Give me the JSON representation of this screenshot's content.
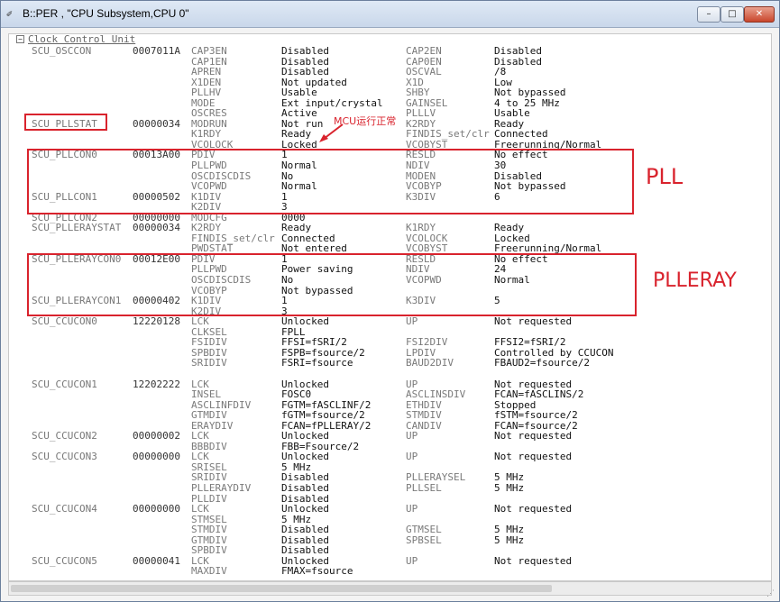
{
  "window": {
    "title": "B::PER , \"CPU Subsystem,CPU 0\"",
    "minimize": "–",
    "maximize": "□",
    "close": "✕"
  },
  "section": {
    "toggle": "−",
    "title": "Clock Control Unit"
  },
  "annotations": {
    "pll": "PLL",
    "plleray": "PLLERAY",
    "note": "MCU运行正常"
  },
  "highlight_color": "#d9232d",
  "rows": [
    [
      "SCU_OSCCON",
      "0007011A",
      "CAP3EN",
      "Disabled",
      "CAP2EN",
      "Disabled"
    ],
    [
      "",
      "",
      "CAP1EN",
      "Disabled",
      "CAP0EN",
      "Disabled"
    ],
    [
      "",
      "",
      "APREN",
      "Disabled",
      "OSCVAL",
      "/8"
    ],
    [
      "",
      "",
      "X1DEN",
      "Not updated",
      "X1D",
      "Low"
    ],
    [
      "",
      "",
      "PLLHV",
      "Usable",
      "SHBY",
      "Not bypassed"
    ],
    [
      "",
      "",
      "MODE",
      "Ext input/crystal",
      "GAINSEL",
      "4 to 25 MHz"
    ],
    [
      "",
      "",
      "OSCRES",
      "Active",
      "PLLLV",
      "Usable"
    ],
    [
      "SCU_PLLSTAT",
      "00000034",
      "MODRUN",
      "Not run",
      "K2RDY",
      "Ready"
    ],
    [
      "",
      "",
      "K1RDY",
      "Ready",
      "FINDIS_set/clr",
      "Connected"
    ],
    [
      "",
      "",
      "VCOLOCK",
      "Locked",
      "VCOBYST",
      "Freerunning/Normal"
    ],
    [
      "SCU_PLLCON0",
      "00013A00",
      "PDIV",
      "1",
      "RESLD",
      "No effect"
    ],
    [
      "",
      "",
      "PLLPWD",
      "Normal",
      "NDIV",
      "30"
    ],
    [
      "",
      "",
      "OSCDISCDIS",
      "No",
      "MODEN",
      "Disabled"
    ],
    [
      "",
      "",
      "VCOPWD",
      "Normal",
      "VCOBYP",
      "Not bypassed"
    ],
    [
      "SCU_PLLCON1",
      "00000502",
      "K1DIV",
      "1",
      "K3DIV",
      "6"
    ],
    [
      "",
      "",
      "K2DIV",
      "3",
      "",
      ""
    ],
    [
      "SCU_PLLCON2",
      "00000000",
      "MODCFG",
      "0000",
      "",
      ""
    ],
    [
      "SCU_PLLERAYSTAT",
      "00000034",
      "K2RDY",
      "Ready",
      "K1RDY",
      "Ready"
    ],
    [
      "",
      "",
      "FINDIS_set/clr",
      "Connected",
      "VCOLOCK",
      "Locked"
    ],
    [
      "",
      "",
      "PWDSTAT",
      "Not entered",
      "VCOBYST",
      "Freerunning/Normal"
    ],
    [
      "SCU_PLLERAYCON0",
      "00012E00",
      "PDIV",
      "1",
      "RESLD",
      "No effect"
    ],
    [
      "",
      "",
      "PLLPWD",
      "Power saving",
      "NDIV",
      "24"
    ],
    [
      "",
      "",
      "OSCDISCDIS",
      "No",
      "VCOPWD",
      "Normal"
    ],
    [
      "",
      "",
      "VCOBYP",
      "Not bypassed",
      "",
      ""
    ],
    [
      "SCU_PLLERAYCON1",
      "00000402",
      "K1DIV",
      "1",
      "K3DIV",
      "5"
    ],
    [
      "",
      "",
      "K2DIV",
      "3",
      "",
      ""
    ],
    [
      "SCU_CCUCON0",
      "12220128",
      "LCK",
      "Unlocked",
      "UP",
      "Not requested"
    ],
    [
      "",
      "",
      "CLKSEL",
      "FPLL",
      "",
      ""
    ],
    [
      "",
      "",
      "FSIDIV",
      "FFSI=fSRI/2",
      "FSI2DIV",
      "FFSI2=fSRI/2"
    ],
    [
      "",
      "",
      "SPBDIV",
      "FSPB=fsource/2",
      "LPDIV",
      "Controlled by CCUCON"
    ],
    [
      "",
      "",
      "SRIDIV",
      "FSRI=fsource",
      "BAUD2DIV",
      "FBAUD2=fsource/2"
    ],
    [
      "",
      "",
      "",
      "",
      "",
      ""
    ],
    [
      "SCU_CCUCON1",
      "12202222",
      "LCK",
      "Unlocked",
      "UP",
      "Not requested"
    ],
    [
      "",
      "",
      "INSEL",
      "FOSC0",
      "ASCLINSDIV",
      "FCAN=fASCLINS/2"
    ],
    [
      "",
      "",
      "ASCLINFDIV",
      "FGTM=fASCLINF/2",
      "ETHDIV",
      "Stopped"
    ],
    [
      "",
      "",
      "GTMDIV",
      "fGTM=fsource/2",
      "STMDIV",
      "fSTM=fsource/2"
    ],
    [
      "",
      "",
      "ERAYDIV",
      "FCAN=fPLLERAY/2",
      "CANDIV",
      "FCAN=fsource/2"
    ],
    [
      "SCU_CCUCON2",
      "00000002",
      "LCK",
      "Unlocked",
      "UP",
      "Not requested"
    ],
    [
      "",
      "",
      "BBBDIV",
      "FBB=Fsource/2",
      "",
      ""
    ],
    [
      "SCU_CCUCON3",
      "00000000",
      "LCK",
      "Unlocked",
      "UP",
      "Not requested"
    ],
    [
      "",
      "",
      "SRISEL",
      "5 MHz",
      "",
      ""
    ],
    [
      "",
      "",
      "SRIDIV",
      "Disabled",
      "PLLERAYSEL",
      "5 MHz"
    ],
    [
      "",
      "",
      "PLLERAYDIV",
      "Disabled",
      "PLLSEL",
      "5 MHz"
    ],
    [
      "",
      "",
      "PLLDIV",
      "Disabled",
      "",
      ""
    ],
    [
      "SCU_CCUCON4",
      "00000000",
      "LCK",
      "Unlocked",
      "UP",
      "Not requested"
    ],
    [
      "",
      "",
      "STMSEL",
      "5 MHz",
      "",
      ""
    ],
    [
      "",
      "",
      "STMDIV",
      "Disabled",
      "GTMSEL",
      "5 MHz"
    ],
    [
      "",
      "",
      "GTMDIV",
      "Disabled",
      "SPBSEL",
      "5 MHz"
    ],
    [
      "",
      "",
      "SPBDIV",
      "Disabled",
      "",
      ""
    ],
    [
      "SCU_CCUCON5",
      "00000041",
      "LCK",
      "Unlocked",
      "UP",
      "Not requested"
    ],
    [
      "",
      "",
      "MAXDIV",
      "FMAX=fsource",
      "",
      ""
    ]
  ]
}
